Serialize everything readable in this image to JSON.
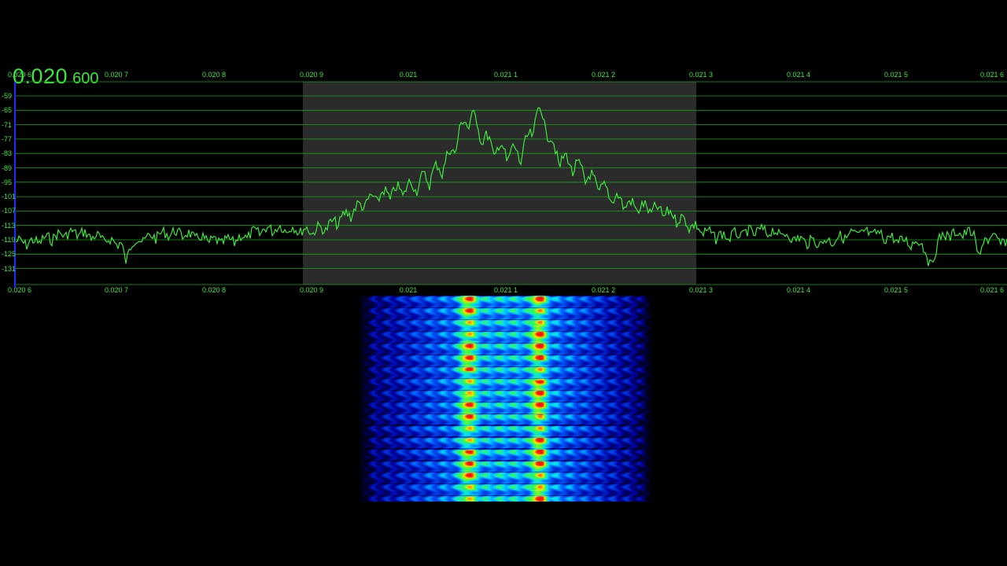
{
  "readout": {
    "main": "0.020",
    "sub": "600"
  },
  "freq_ticks": [
    "0.020 6",
    "0.020 7",
    "0.020 8",
    "0.020 9",
    "0.021",
    "0.021 1",
    "0.021 2",
    "0.021 3",
    "0.021 4",
    "0.021 5",
    "0.021 6"
  ],
  "db_scale": [
    "-59",
    "-65",
    "-71",
    "-77",
    "-83",
    "-89",
    "-95",
    "-101",
    "-107",
    "-113",
    "-119",
    "-125",
    "-131"
  ],
  "colors": {
    "trace": "#3ce83c",
    "grid": "#17a817",
    "selection": "#2b2b2b",
    "scale_bar": "#1a2dff"
  }
}
